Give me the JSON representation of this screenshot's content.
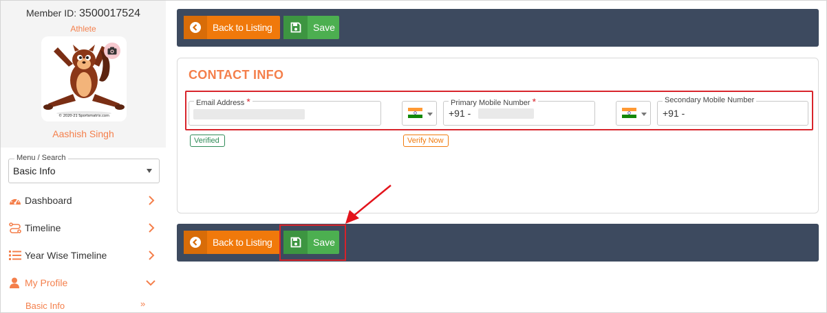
{
  "sidebar": {
    "member_id_label": "Member ID:",
    "member_id": "3500017524",
    "role": "Athlete",
    "avatar_caption": "© 2020-21 Sportsmatrix.com",
    "name": "Aashish Singh",
    "menu_search": {
      "legend": "Menu / Search",
      "value": "Basic Info"
    },
    "nav": [
      {
        "label": "Dashboard",
        "icon": "dashboard-icon"
      },
      {
        "label": "Timeline",
        "icon": "timeline-icon"
      },
      {
        "label": "Year Wise Timeline",
        "icon": "list-icon"
      },
      {
        "label": "My Profile",
        "icon": "user-icon"
      }
    ],
    "sub_item": "Basic Info",
    "sub_chevron": "»"
  },
  "toolbar": {
    "back_label": "Back to Listing",
    "save_label": "Save"
  },
  "contact": {
    "title": "CONTACT INFO",
    "email": {
      "label": "Email Address",
      "required": "*"
    },
    "primary": {
      "label": "Primary Mobile Number",
      "required": "*",
      "prefix": "+91 -"
    },
    "secondary": {
      "label": "Secondary Mobile Number",
      "prefix": "+91 -"
    },
    "verified_badge": "Verified",
    "verify_now_badge": "Verify Now"
  },
  "colors": {
    "accent": "#f47f4b",
    "toolbar_bg": "#3d4a5f",
    "back_button": "#f0790b",
    "save_button": "#4caf50",
    "annotation": "#d8232a"
  }
}
